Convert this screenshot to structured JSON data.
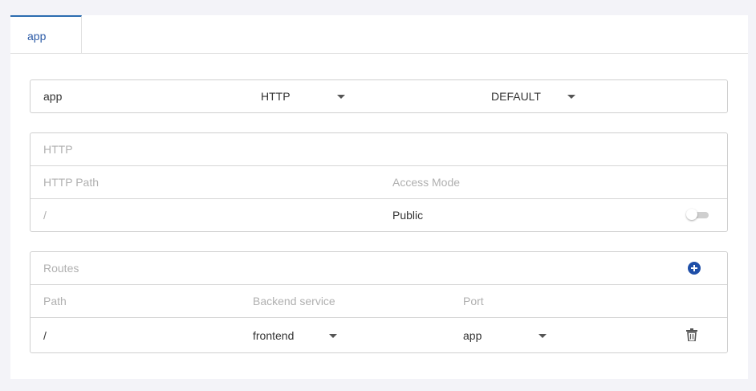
{
  "tabs": [
    {
      "label": "app",
      "active": true
    }
  ],
  "service": {
    "name": "app",
    "protocol": "HTTP",
    "mode": "DEFAULT"
  },
  "http": {
    "title": "HTTP",
    "headers": {
      "path": "HTTP Path",
      "access_mode": "Access Mode"
    },
    "row": {
      "path": "/",
      "access_mode": "Public",
      "toggle_on": false
    }
  },
  "routes": {
    "title": "Routes",
    "add_icon": "plus-circle-icon",
    "headers": {
      "path": "Path",
      "backend": "Backend service",
      "port": "Port"
    },
    "items": [
      {
        "path": "/",
        "backend": "frontend",
        "port": "app",
        "delete_icon": "trash-icon"
      }
    ]
  },
  "colors": {
    "accent": "#2b6cb0",
    "add_button": "#1f4fa8",
    "muted_text": "#b0b0b0",
    "border": "#cfcfcf"
  }
}
